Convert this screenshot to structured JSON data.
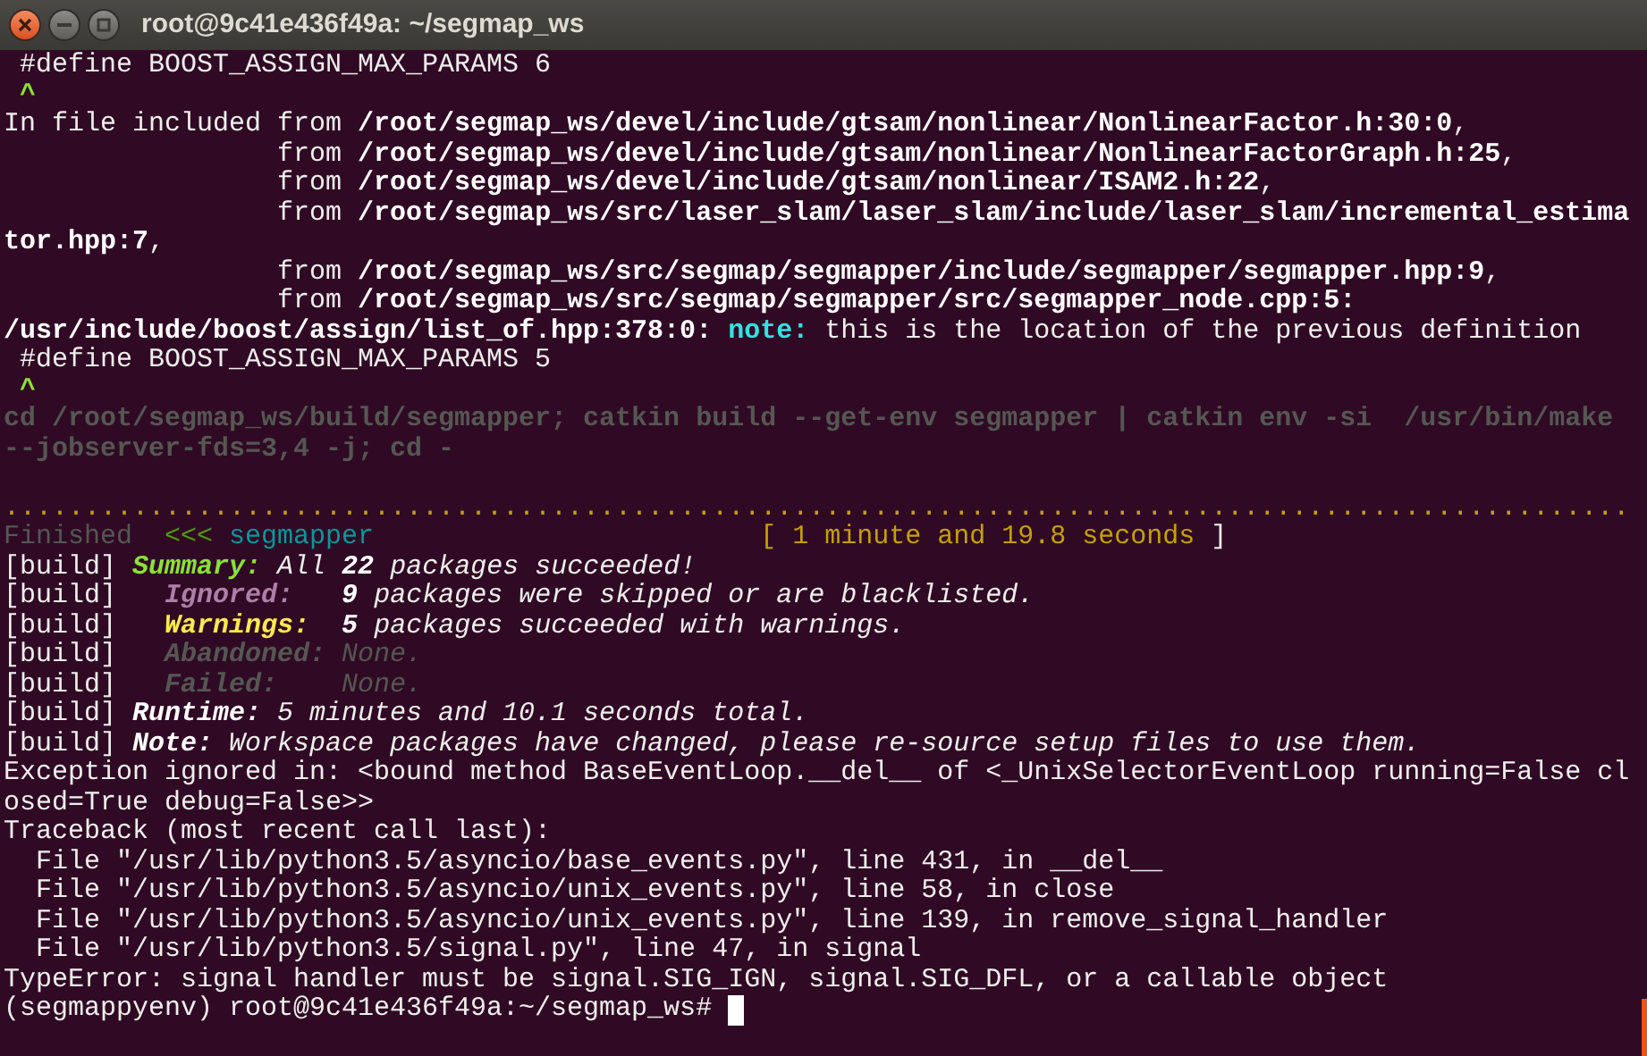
{
  "window": {
    "title": "root@9c41e436f49a: ~/segmap_ws"
  },
  "terminal": {
    "lines": [
      {
        "kind": "text",
        "segments": [
          {
            "text": " #define BOOST_ASSIGN_MAX_PARAMS 6",
            "kind": "plain"
          }
        ]
      },
      {
        "kind": "text",
        "segments": [
          {
            "text": " ^",
            "kind": "caret"
          }
        ]
      },
      {
        "kind": "text",
        "segments": [
          {
            "text": "In file included from ",
            "kind": "plain"
          },
          {
            "text": "/root/segmap_ws/devel/include/gtsam/nonlinear/NonlinearFactor.h:30:0",
            "kind": "bold"
          },
          {
            "text": ",",
            "kind": "plain"
          }
        ]
      },
      {
        "kind": "text",
        "segments": [
          {
            "text": "                 from ",
            "kind": "plain"
          },
          {
            "text": "/root/segmap_ws/devel/include/gtsam/nonlinear/NonlinearFactorGraph.h:25",
            "kind": "bold"
          },
          {
            "text": ",",
            "kind": "plain"
          }
        ]
      },
      {
        "kind": "text",
        "segments": [
          {
            "text": "                 from ",
            "kind": "plain"
          },
          {
            "text": "/root/segmap_ws/devel/include/gtsam/nonlinear/ISAM2.h:22",
            "kind": "bold"
          },
          {
            "text": ",",
            "kind": "plain"
          }
        ]
      },
      {
        "kind": "text",
        "segments": [
          {
            "text": "                 from ",
            "kind": "plain"
          },
          {
            "text": "/root/segmap_ws/src/laser_slam/laser_slam/include/laser_slam/incremental_estima",
            "kind": "bold"
          }
        ]
      },
      {
        "kind": "text",
        "segments": [
          {
            "text": "tor.hpp:7",
            "kind": "bold"
          },
          {
            "text": ",",
            "kind": "plain"
          }
        ]
      },
      {
        "kind": "text",
        "segments": [
          {
            "text": "                 from ",
            "kind": "plain"
          },
          {
            "text": "/root/segmap_ws/src/segmap/segmapper/include/segmapper/segmapper.hpp:9",
            "kind": "bold"
          },
          {
            "text": ",",
            "kind": "plain"
          }
        ]
      },
      {
        "kind": "text",
        "segments": [
          {
            "text": "                 from ",
            "kind": "plain"
          },
          {
            "text": "/root/segmap_ws/src/segmap/segmapper/src/segmapper_node.cpp:5:",
            "kind": "bold"
          }
        ]
      },
      {
        "kind": "text",
        "segments": [
          {
            "text": "/usr/include/boost/assign/list_of.hpp:378:0: ",
            "kind": "bold"
          },
          {
            "text": "note:",
            "kind": "note"
          },
          {
            "text": " this is the location of the previous definition",
            "kind": "plain"
          }
        ]
      },
      {
        "kind": "text",
        "segments": [
          {
            "text": " #define BOOST_ASSIGN_MAX_PARAMS 5",
            "kind": "plain"
          }
        ]
      },
      {
        "kind": "text",
        "segments": [
          {
            "text": " ^",
            "kind": "caret"
          }
        ]
      },
      {
        "kind": "text",
        "segments": [
          {
            "text": "cd /root/segmap_ws/build/segmapper; catkin build --get-env segmapper | catkin env -si  /usr/bin/make",
            "kind": "dim_bold"
          }
        ]
      },
      {
        "kind": "text",
        "segments": [
          {
            "text": "--jobserver-fds=3,4 -j; cd -",
            "kind": "dim_bold"
          }
        ]
      },
      {
        "kind": "blank"
      },
      {
        "kind": "text",
        "segments": [
          {
            "text": ".....................................................................................................",
            "kind": "dots"
          }
        ]
      },
      {
        "kind": "text",
        "segments": [
          {
            "text": "Finished  ",
            "kind": "dim"
          },
          {
            "text": "<<< ",
            "kind": "arrow"
          },
          {
            "text": "segmapper                        ",
            "kind": "package"
          },
          {
            "text": "[ 1 minute and 19.8 seconds",
            "kind": "time"
          },
          {
            "text": " ]",
            "kind": "plain"
          }
        ]
      },
      {
        "kind": "text",
        "segments": [
          {
            "text": "[build] ",
            "kind": "plain"
          },
          {
            "text": "Summary:",
            "kind": "summary"
          },
          {
            "text": " All ",
            "kind": "italic"
          },
          {
            "text": "22",
            "kind": "bold_italic"
          },
          {
            "text": " packages succeeded!",
            "kind": "italic"
          }
        ]
      },
      {
        "kind": "text",
        "segments": [
          {
            "text": "[build]   ",
            "kind": "plain"
          },
          {
            "text": "Ignored:   ",
            "kind": "ignored"
          },
          {
            "text": "9",
            "kind": "bold_italic"
          },
          {
            "text": " packages were skipped or are blacklisted.",
            "kind": "italic"
          }
        ]
      },
      {
        "kind": "text",
        "segments": [
          {
            "text": "[build]   ",
            "kind": "plain"
          },
          {
            "text": "Warnings:  ",
            "kind": "warnings"
          },
          {
            "text": "5",
            "kind": "bold_italic"
          },
          {
            "text": " packages succeeded with warnings.",
            "kind": "italic"
          }
        ]
      },
      {
        "kind": "text",
        "segments": [
          {
            "text": "[build]   ",
            "kind": "plain"
          },
          {
            "text": "Abandoned:",
            "kind": "dim_bold_italic"
          },
          {
            "text": " None.",
            "kind": "dim_italic"
          }
        ]
      },
      {
        "kind": "text",
        "segments": [
          {
            "text": "[build]   ",
            "kind": "plain"
          },
          {
            "text": "Failed:",
            "kind": "dim_bold_italic"
          },
          {
            "text": "    None.",
            "kind": "dim_italic"
          }
        ]
      },
      {
        "kind": "text",
        "segments": [
          {
            "text": "[build] ",
            "kind": "plain"
          },
          {
            "text": "Runtime:",
            "kind": "bold_italic"
          },
          {
            "text": " 5 minutes and 10.1 seconds total.",
            "kind": "italic"
          }
        ]
      },
      {
        "kind": "text",
        "segments": [
          {
            "text": "[build] ",
            "kind": "plain"
          },
          {
            "text": "Note:",
            "kind": "bold_italic"
          },
          {
            "text": " Workspace packages have changed, please re-source setup files to use them.",
            "kind": "italic"
          }
        ]
      },
      {
        "kind": "text",
        "segments": [
          {
            "text": "Exception ignored in: <bound method BaseEventLoop.__del__ of <_UnixSelectorEventLoop running=False cl",
            "kind": "plain"
          }
        ]
      },
      {
        "kind": "text",
        "segments": [
          {
            "text": "osed=True debug=False>>",
            "kind": "plain"
          }
        ]
      },
      {
        "kind": "text",
        "segments": [
          {
            "text": "Traceback (most recent call last):",
            "kind": "plain"
          }
        ]
      },
      {
        "kind": "text",
        "segments": [
          {
            "text": "  File \"/usr/lib/python3.5/asyncio/base_events.py\", line 431, in __del__",
            "kind": "plain"
          }
        ]
      },
      {
        "kind": "text",
        "segments": [
          {
            "text": "  File \"/usr/lib/python3.5/asyncio/unix_events.py\", line 58, in close",
            "kind": "plain"
          }
        ]
      },
      {
        "kind": "text",
        "segments": [
          {
            "text": "  File \"/usr/lib/python3.5/asyncio/unix_events.py\", line 139, in remove_signal_handler",
            "kind": "plain"
          }
        ]
      },
      {
        "kind": "text",
        "segments": [
          {
            "text": "  File \"/usr/lib/python3.5/signal.py\", line 47, in signal",
            "kind": "plain"
          }
        ]
      },
      {
        "kind": "text",
        "segments": [
          {
            "text": "TypeError: signal handler must be signal.SIG_IGN, signal.SIG_DFL, or a callable object",
            "kind": "plain"
          }
        ]
      },
      {
        "kind": "prompt",
        "segments": [
          {
            "text": "(segmappyenv) root@9c41e436f49a:~/segmap_ws# ",
            "kind": "plain"
          }
        ]
      }
    ]
  }
}
